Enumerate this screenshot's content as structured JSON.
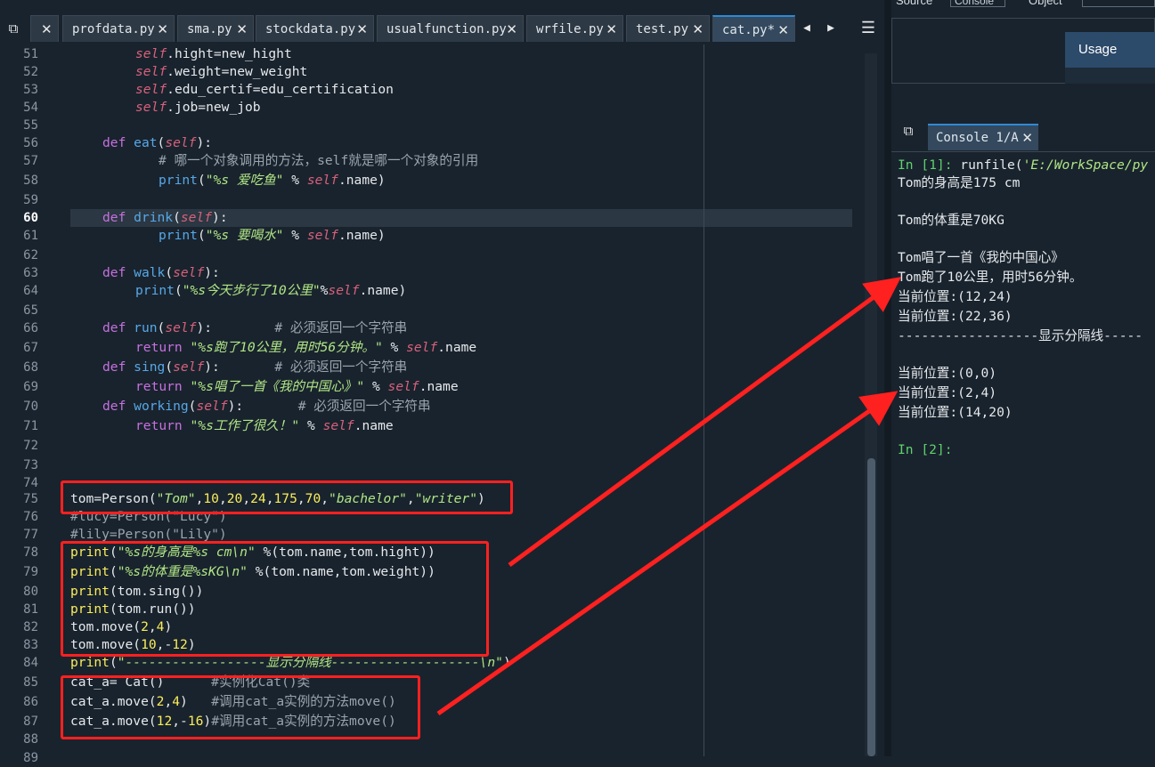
{
  "editor": {
    "tabs": [
      {
        "label": "profdata.py",
        "active": false
      },
      {
        "label": "sma.py",
        "active": false
      },
      {
        "label": "stockdata.py",
        "active": false
      },
      {
        "label": "usualfunction.py",
        "active": false
      },
      {
        "label": "wrfile.py",
        "active": false
      },
      {
        "label": "test.py",
        "active": false
      },
      {
        "label": "cat.py*",
        "active": true
      }
    ],
    "tab_close_glyph": "✕",
    "current_line": 60,
    "line_numbers": [
      "51",
      "52",
      "53",
      "54",
      "55",
      "56",
      "57",
      "58",
      "59",
      "60",
      "61",
      "62",
      "63",
      "64",
      "65",
      "66",
      "67",
      "68",
      "69",
      "70",
      "71",
      "72",
      "73",
      "74",
      "75",
      "76",
      "77",
      "78",
      "79",
      "80",
      "81",
      "82",
      "83",
      "84",
      "85",
      "86",
      "87",
      "88",
      "89"
    ],
    "code": {
      "l51": {
        "a": "self",
        "b": ".hight=new_hight"
      },
      "l52": {
        "a": "self",
        "b": ".weight=new_weight"
      },
      "l53": {
        "a": "self",
        "b": ".edu_certif=edu_certification"
      },
      "l54": {
        "a": "self",
        "b": ".job=new_job"
      },
      "l56": {
        "kw": "def",
        "fn": "eat",
        "p1": "(",
        "self": "self",
        "p2": "):"
      },
      "l57": {
        "comment": "# 哪一个对象调用的方法，self就是哪一个对象的引用"
      },
      "l58": {
        "fn": "print",
        "p1": "(",
        "str": "\"%s 爱吃鱼\"",
        "op": " % ",
        "self": "self",
        "rest": ".name)"
      },
      "l60": {
        "kw": "def",
        "fn": "drink",
        "p1": "(",
        "self": "self",
        "p2": "):"
      },
      "l61": {
        "fn": "print",
        "p1": "(",
        "str": "\"%s 要喝水\"",
        "op": " % ",
        "self": "self",
        "rest": ".name)"
      },
      "l63": {
        "kw": "def",
        "fn": "walk",
        "p1": "(",
        "self": "self",
        "p2": "):"
      },
      "l64": {
        "fn": "print",
        "p1": "(",
        "str": "\"%s今天步行了10公里\"",
        "op": "%",
        "self": "self",
        "rest": ".name)"
      },
      "l66": {
        "kw": "def",
        "fn": "run",
        "p1": "(",
        "self": "self",
        "p2": "):",
        "comment": "        # 必须返回一个字符串"
      },
      "l67": {
        "kw": "return",
        "str": " \"%s跑了10公里，用时56分钟。\"",
        "op": " % ",
        "self": "self",
        "rest": ".name"
      },
      "l68": {
        "kw": "def",
        "fn": "sing",
        "p1": "(",
        "self": "self",
        "p2": "):",
        "comment": "       # 必须返回一个字符串"
      },
      "l69": {
        "kw": "return",
        "str": " \"%s唱了一首《我的中国心》\"",
        "op": " % ",
        "self": "self",
        "rest": ".name"
      },
      "l70": {
        "kw": "def",
        "fn": "working",
        "p1": "(",
        "self": "self",
        "p2": "):",
        "comment": "       # 必须返回一个字符串"
      },
      "l71": {
        "kw": "return",
        "str": " \"%s工作了很久！\"",
        "op": " % ",
        "self": "self",
        "rest": ".name"
      },
      "l76": {
        "a": "tom=Person(",
        "s1": "\"Tom\"",
        "c1": ",",
        "n1": "10",
        "c2": ",",
        "n2": "20",
        "c3": ",",
        "n3": "24",
        "c4": ",",
        "n4": "175",
        "c5": ",",
        "n5": "70",
        "c6": ",",
        "s2": "\"bachelor\"",
        "c7": ",",
        "s3": "\"writer\"",
        "end": ")"
      },
      "l77": {
        "comment": "#lucy=Person(\"Lucy\")"
      },
      "l78": {
        "comment": "#lily=Person(\"Lily\")"
      },
      "l79": {
        "fn": "print",
        "p1": "(",
        "str": "\"%s的身高是%s cm\\n\"",
        "rest": " %(tom.name,tom.hight))"
      },
      "l80": {
        "fn": "print",
        "p1": "(",
        "str": "\"%s的体重是%sKG\\n\"",
        "rest": " %(tom.name,tom.weight))"
      },
      "l81": {
        "fn": "print",
        "rest": "(tom.sing())"
      },
      "l82": {
        "fn": "print",
        "rest": "(tom.run())"
      },
      "l83": {
        "a": "tom.move(",
        "n1": "2",
        "c1": ",",
        "n2": "4",
        "end": ")"
      },
      "l84": {
        "a": "tom.move(",
        "n1": "10",
        "c1": ",-",
        "n2": "12",
        "end": ")"
      },
      "l85": {
        "fn": "print",
        "p1": "(",
        "str": "\"------------------显示分隔线-------------------\\n\"",
        "end": ")"
      },
      "l86": {
        "a": "cat_a= Cat()",
        "comment": "      #实例化Cat()类"
      },
      "l87": {
        "a": "cat_a.move(",
        "n1": "2",
        "c1": ",",
        "n2": "4",
        "end": ")",
        "comment": "   #调用cat_a实例的方法move()"
      },
      "l88": {
        "a": "cat_a.move(",
        "n1": "12",
        "c1": ",-",
        "n2": "16",
        "end": ")",
        "comment": "#调用cat_a实例的方法move()"
      }
    }
  },
  "help_pane": {
    "labels": [
      "Source",
      "Console",
      "Object"
    ],
    "usage_label": "Usage"
  },
  "console": {
    "tab_label": "Console 1/A",
    "lines": {
      "in1_prompt": "In [1]:",
      "in1_cmd": " runfile(",
      "in1_arg": "'E:/WorkSpace/py",
      "o1": "Tom的身高是175 cm",
      "o2": "Tom的体重是70KG",
      "o3": "Tom唱了一首《我的中国心》",
      "o4": "Tom跑了10公里，用时56分钟。",
      "o5": "当前位置:(12,24)",
      "o6": "当前位置:(22,36)",
      "o7": "------------------显示分隔线-----",
      "o8": "当前位置:(0,0)",
      "o9": "当前位置:(2,4)",
      "o10": "当前位置:(14,20)",
      "in2_prompt": "In [2]:"
    }
  },
  "colors": {
    "background": "#19232d",
    "keyword": "#c670e0",
    "function": "#57a8e8",
    "string": "#b0e686",
    "self": "#d7617c",
    "number": "#faed5c",
    "annotation": "#ff2020"
  }
}
